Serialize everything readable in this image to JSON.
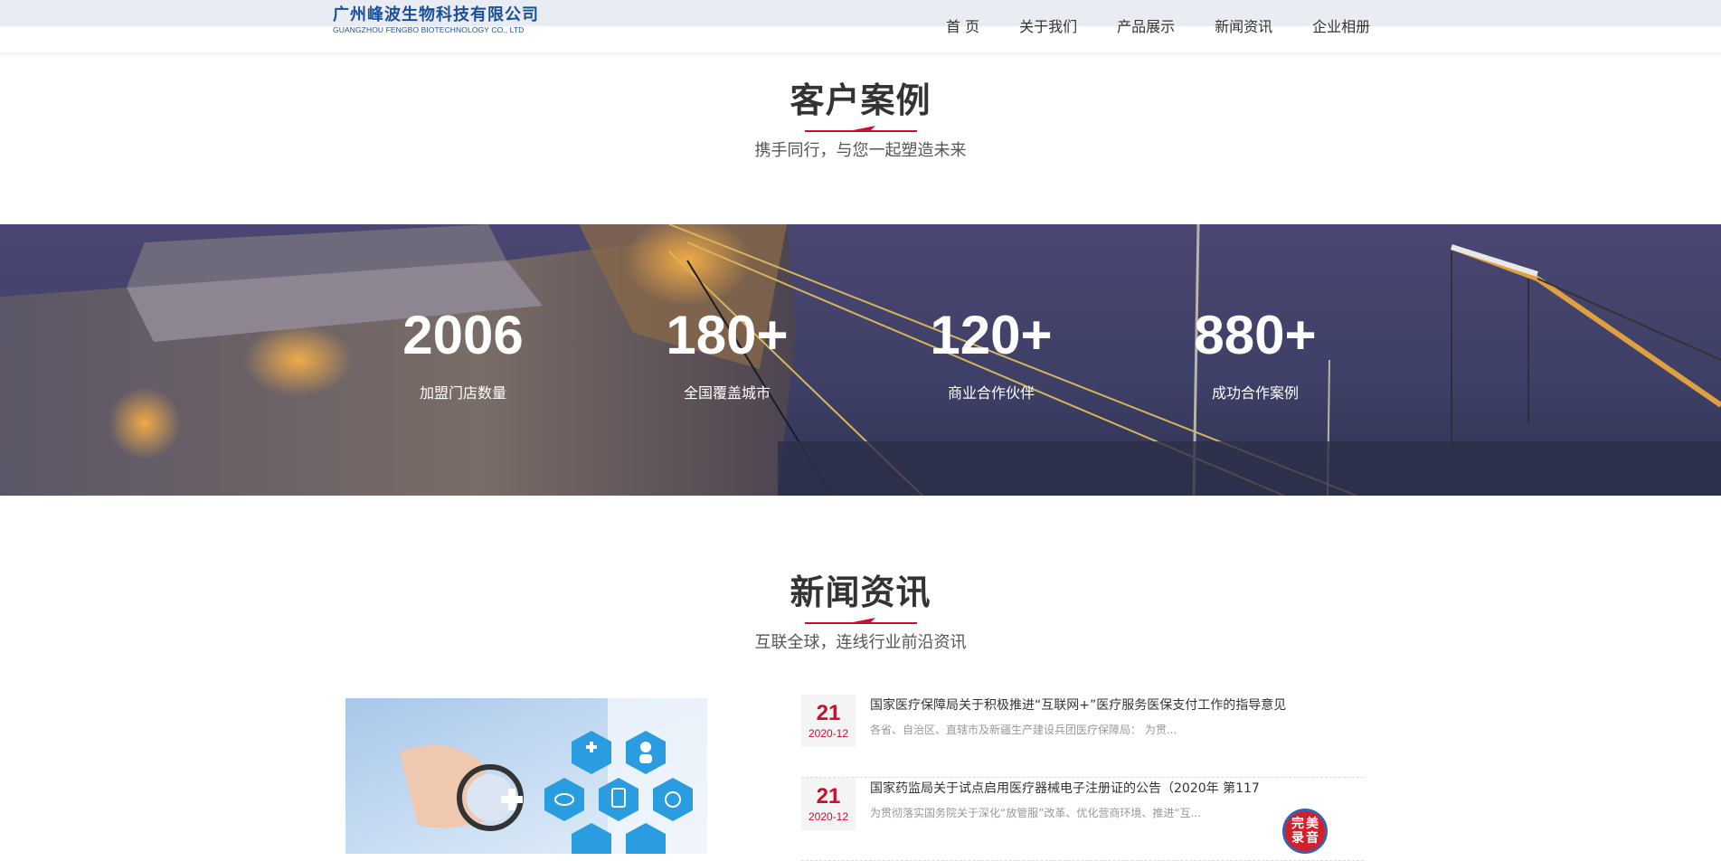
{
  "header": {
    "logo_cn": "广州峰波生物科技有限公司",
    "logo_en": "GUANGZHOU FENGBO BIOTECHNOLOGY CO., LTD",
    "nav": [
      "首 页",
      "关于我们",
      "产品展示",
      "新闻资讯",
      "企业相册"
    ]
  },
  "cases": {
    "title": "客户案例",
    "subtitle": "携手同行，与您一起塑造未来"
  },
  "stats": [
    {
      "value": "2006",
      "label": "加盟门店数量"
    },
    {
      "value": "180+",
      "label": "全国覆盖城市"
    },
    {
      "value": "120+",
      "label": "商业合作伙伴"
    },
    {
      "value": "880+",
      "label": "成功合作案例"
    }
  ],
  "news": {
    "title": "新闻资讯",
    "subtitle": "互联全球，连线行业前沿资讯",
    "items": [
      {
        "day": "21",
        "ym": "2020-12",
        "title": "国家医疗保障局关于积极推进“互联网+”医疗服务医保支付工作的指导意见",
        "desc": "各省、自治区、直辖市及新疆生产建设兵团医疗保障局：  为贯..."
      },
      {
        "day": "21",
        "ym": "2020-12",
        "title": "国家药监局关于试点启用医疗器械电子注册证的公告（2020年 第117",
        "desc": "为贯彻落实国务院关于深化“放管服”改革、优化营商环境、推进“互..."
      }
    ]
  },
  "badge": {
    "chars": [
      "完",
      "美",
      "录",
      "音"
    ]
  },
  "colors": {
    "accent": "#c8102e",
    "brand": "#1a4f9c"
  }
}
